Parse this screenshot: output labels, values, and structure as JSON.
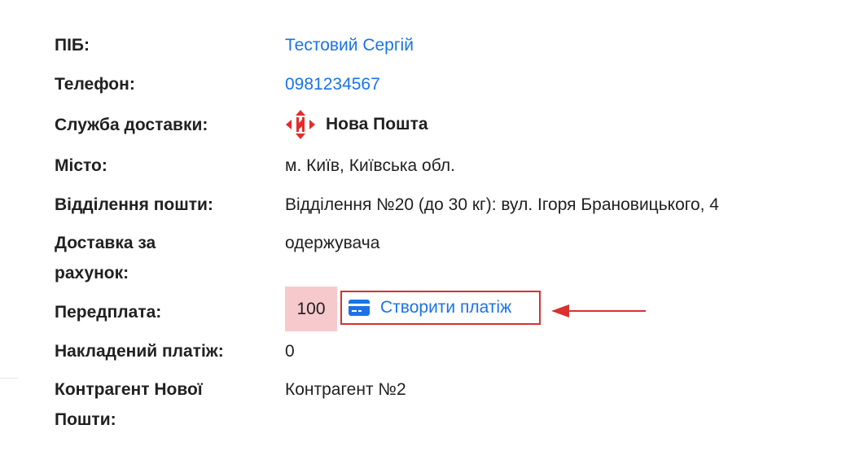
{
  "order_details": {
    "name": {
      "label": "ПІБ:",
      "value": "Тестовий Сергій"
    },
    "phone": {
      "label": "Телефон:",
      "value": "0981234567"
    },
    "delivery_service": {
      "label": "Служба доставки:",
      "value": "Нова Пошта",
      "icon": "nova-poshta-logo-icon"
    },
    "city": {
      "label": "Місто:",
      "value": "м. Київ, Київська обл."
    },
    "post_office": {
      "label": "Відділення пошти:",
      "value": "Відділення №20 (до 30 кг): вул. Ігоря Брановицького, 4"
    },
    "delivery_payer": {
      "label_line1": "Доставка за",
      "label_line2": "рахунок:",
      "value": "одержувача"
    },
    "prepayment": {
      "label": "Передплата:",
      "value": "100",
      "button_label": "Створити платіж",
      "button_icon": "credit-card-icon"
    },
    "cod": {
      "label": "Накладений платіж:",
      "value": "0"
    },
    "counterparty": {
      "label_line1": "Контрагент Нової",
      "label_line2": "Пошти:",
      "value": "Контрагент №2"
    }
  },
  "colors": {
    "link": "#1a73e8",
    "prepay_highlight": "#f6c9cd",
    "annotation_red": "#d93030",
    "nova_poshta_red": "#e52b2b"
  }
}
